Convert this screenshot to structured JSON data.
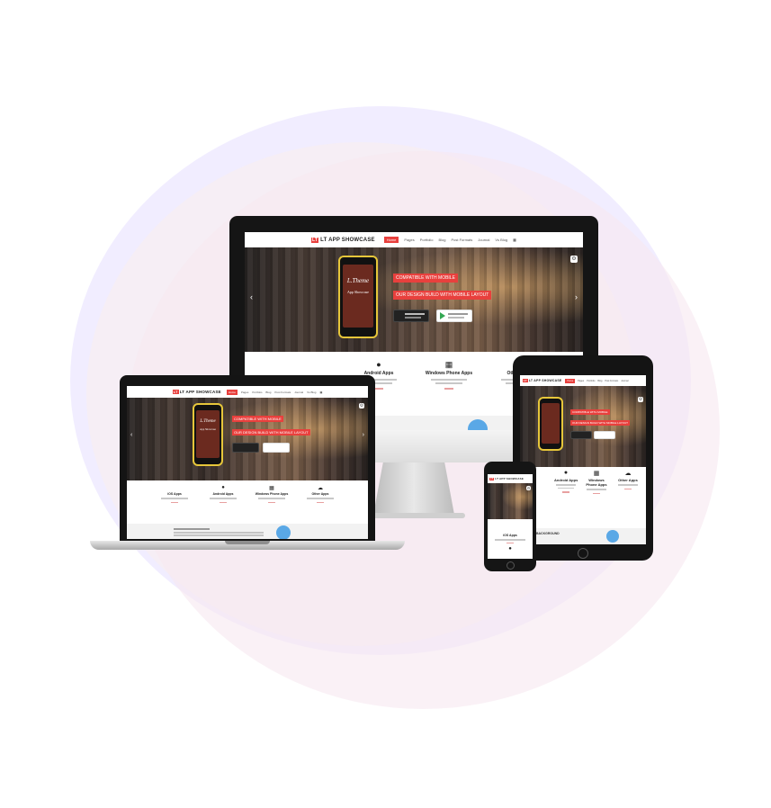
{
  "site": {
    "logo_mark": "LT",
    "logo_text": "LT APP SHOWCASE",
    "nav": [
      "Home",
      "Pages",
      "Portfolio",
      "Blog",
      "Post Formats",
      "Journal",
      "Vs Blog"
    ],
    "hero": {
      "phone_title": "L.Theme",
      "phone_subtitle": "App Showcase",
      "headline": "COMPATIBLE WITH MOBILE",
      "subline": "OUR DESIGN BUILD WITH MOBILE LAYOUT",
      "app_store": "Download from APP STORE",
      "google_play": "Download from GOOGLE PLAY"
    },
    "features": [
      {
        "icon": "apple-icon",
        "title": "iOS Apps"
      },
      {
        "icon": "android-icon",
        "title": "Android Apps"
      },
      {
        "icon": "windows-icon",
        "title": "Windows Phone Apps"
      },
      {
        "icon": "cloud-icon",
        "title": "Other Apps"
      }
    ],
    "section_label": "BACKGROUND",
    "menu_icon": "grid-icon"
  },
  "colors": {
    "accent": "#e8403d",
    "device_dark": "#151515",
    "blob_lavender": "#ece6ff",
    "blob_pink": "#f7e8f0"
  }
}
